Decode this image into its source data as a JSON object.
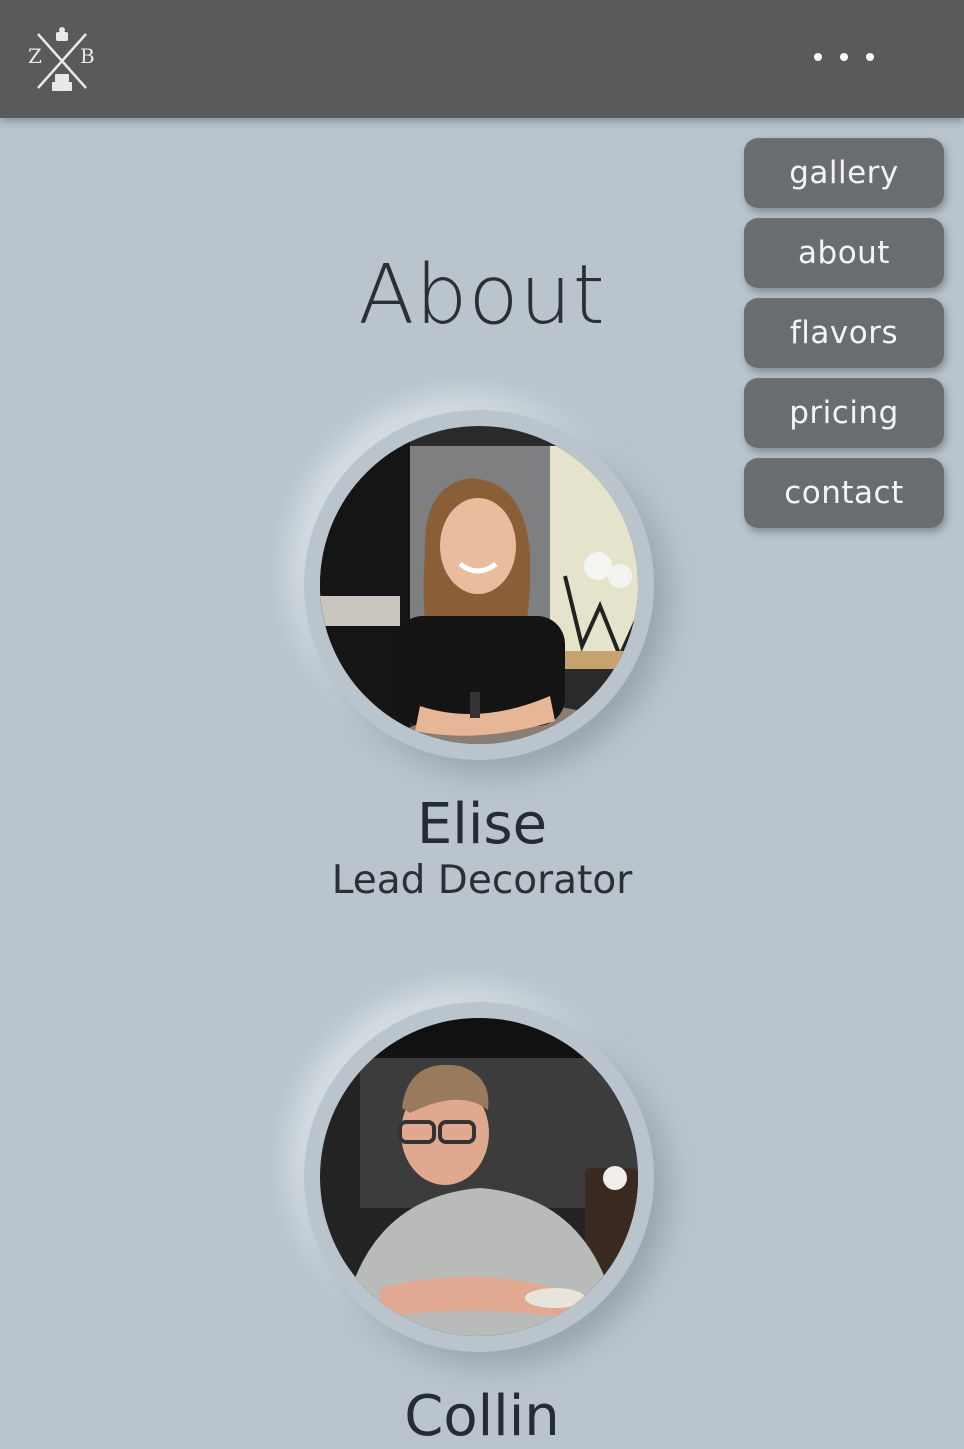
{
  "header": {
    "logo": {
      "icon": "zb-cake-logo-icon",
      "letter_left": "Z",
      "letter_right": "B"
    },
    "menu_icon": "ellipsis-menu-icon"
  },
  "nav": {
    "items": [
      {
        "label": "gallery"
      },
      {
        "label": "about"
      },
      {
        "label": "flavors"
      },
      {
        "label": "pricing"
      },
      {
        "label": "contact"
      }
    ]
  },
  "main": {
    "title": "About",
    "team": [
      {
        "name": "Elise",
        "role": "Lead Decorator",
        "photo": "portrait-photo-elise"
      },
      {
        "name": "Collin",
        "role": "",
        "photo": "portrait-photo-collin"
      }
    ]
  },
  "colors": {
    "background": "#b9c4cd",
    "header": "#5a5a5b",
    "nav_button": "#6a6d70",
    "text": "#272d36"
  }
}
